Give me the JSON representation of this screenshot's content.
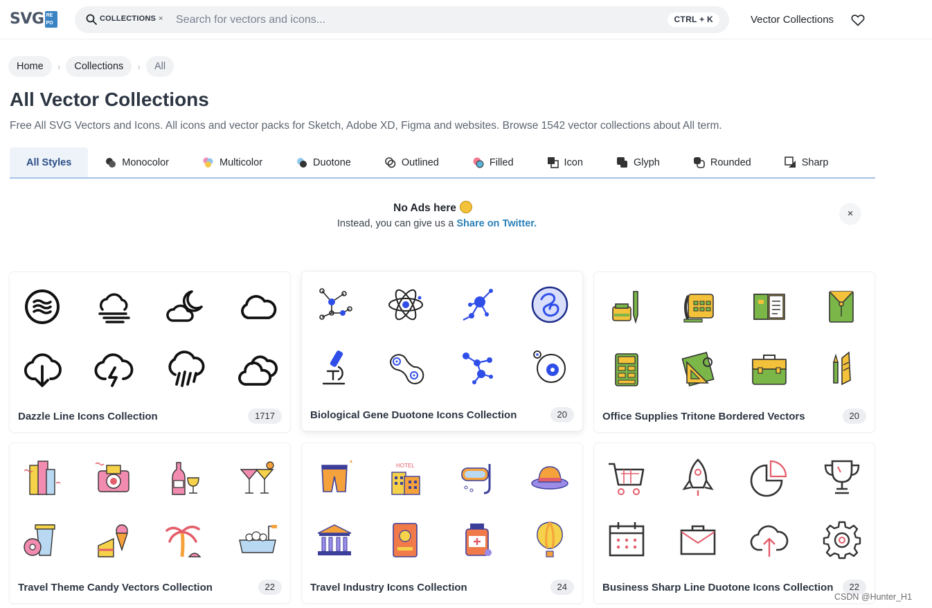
{
  "header": {
    "logo_text": "SVG",
    "logo_box": [
      "RE",
      "PO"
    ],
    "search_chip": "COLLECTIONS",
    "search_chip_close": "×",
    "search_placeholder": "Search for vectors and icons...",
    "shortcut": "CTRL + K",
    "nav_link": "Vector Collections"
  },
  "breadcrumb": {
    "items": [
      "Home",
      "Collections",
      "All"
    ],
    "separator": "›"
  },
  "page": {
    "title": "All Vector Collections",
    "description": "Free All SVG Vectors and Icons. All icons and vector packs for Sketch, Adobe XD, Figma and websites. Browse 1542 vector collections about All term."
  },
  "tabs": [
    {
      "label": "All Styles",
      "icon": "none",
      "active": true
    },
    {
      "label": "Monocolor",
      "icon": "monocolor-icon"
    },
    {
      "label": "Multicolor",
      "icon": "multicolor-icon"
    },
    {
      "label": "Duotone",
      "icon": "duotone-icon"
    },
    {
      "label": "Outlined",
      "icon": "outlined-icon"
    },
    {
      "label": "Filled",
      "icon": "filled-icon"
    },
    {
      "label": "Icon",
      "icon": "icon-style-icon"
    },
    {
      "label": "Glyph",
      "icon": "glyph-icon"
    },
    {
      "label": "Rounded",
      "icon": "rounded-icon"
    },
    {
      "label": "Sharp",
      "icon": "sharp-icon"
    }
  ],
  "ads": {
    "title": "No Ads here",
    "subtitle_prefix": "Instead, you can give us a",
    "subtitle_link": "Share on Twitter.",
    "close": "×"
  },
  "collections": [
    {
      "title": "Dazzle Line Icons Collection",
      "count": "1717",
      "accent": "#111111"
    },
    {
      "title": "Biological Gene Duotone Icons Collection",
      "count": "20",
      "accent": "#2f4ee8"
    },
    {
      "title": "Office Supplies Tritone Bordered Vectors",
      "count": "20",
      "accent": "#7ab648"
    },
    {
      "title": "Travel Theme Candy Vectors Collection",
      "count": "22",
      "accent": "#f28bb0"
    },
    {
      "title": "Travel Industry Icons Collection",
      "count": "24",
      "accent": "#f5a23c"
    },
    {
      "title": "Business Sharp Line Duotone Icons Collection",
      "count": "22",
      "accent": "#e63b3b"
    }
  ],
  "watermark": "CSDN @Hunter_H1"
}
